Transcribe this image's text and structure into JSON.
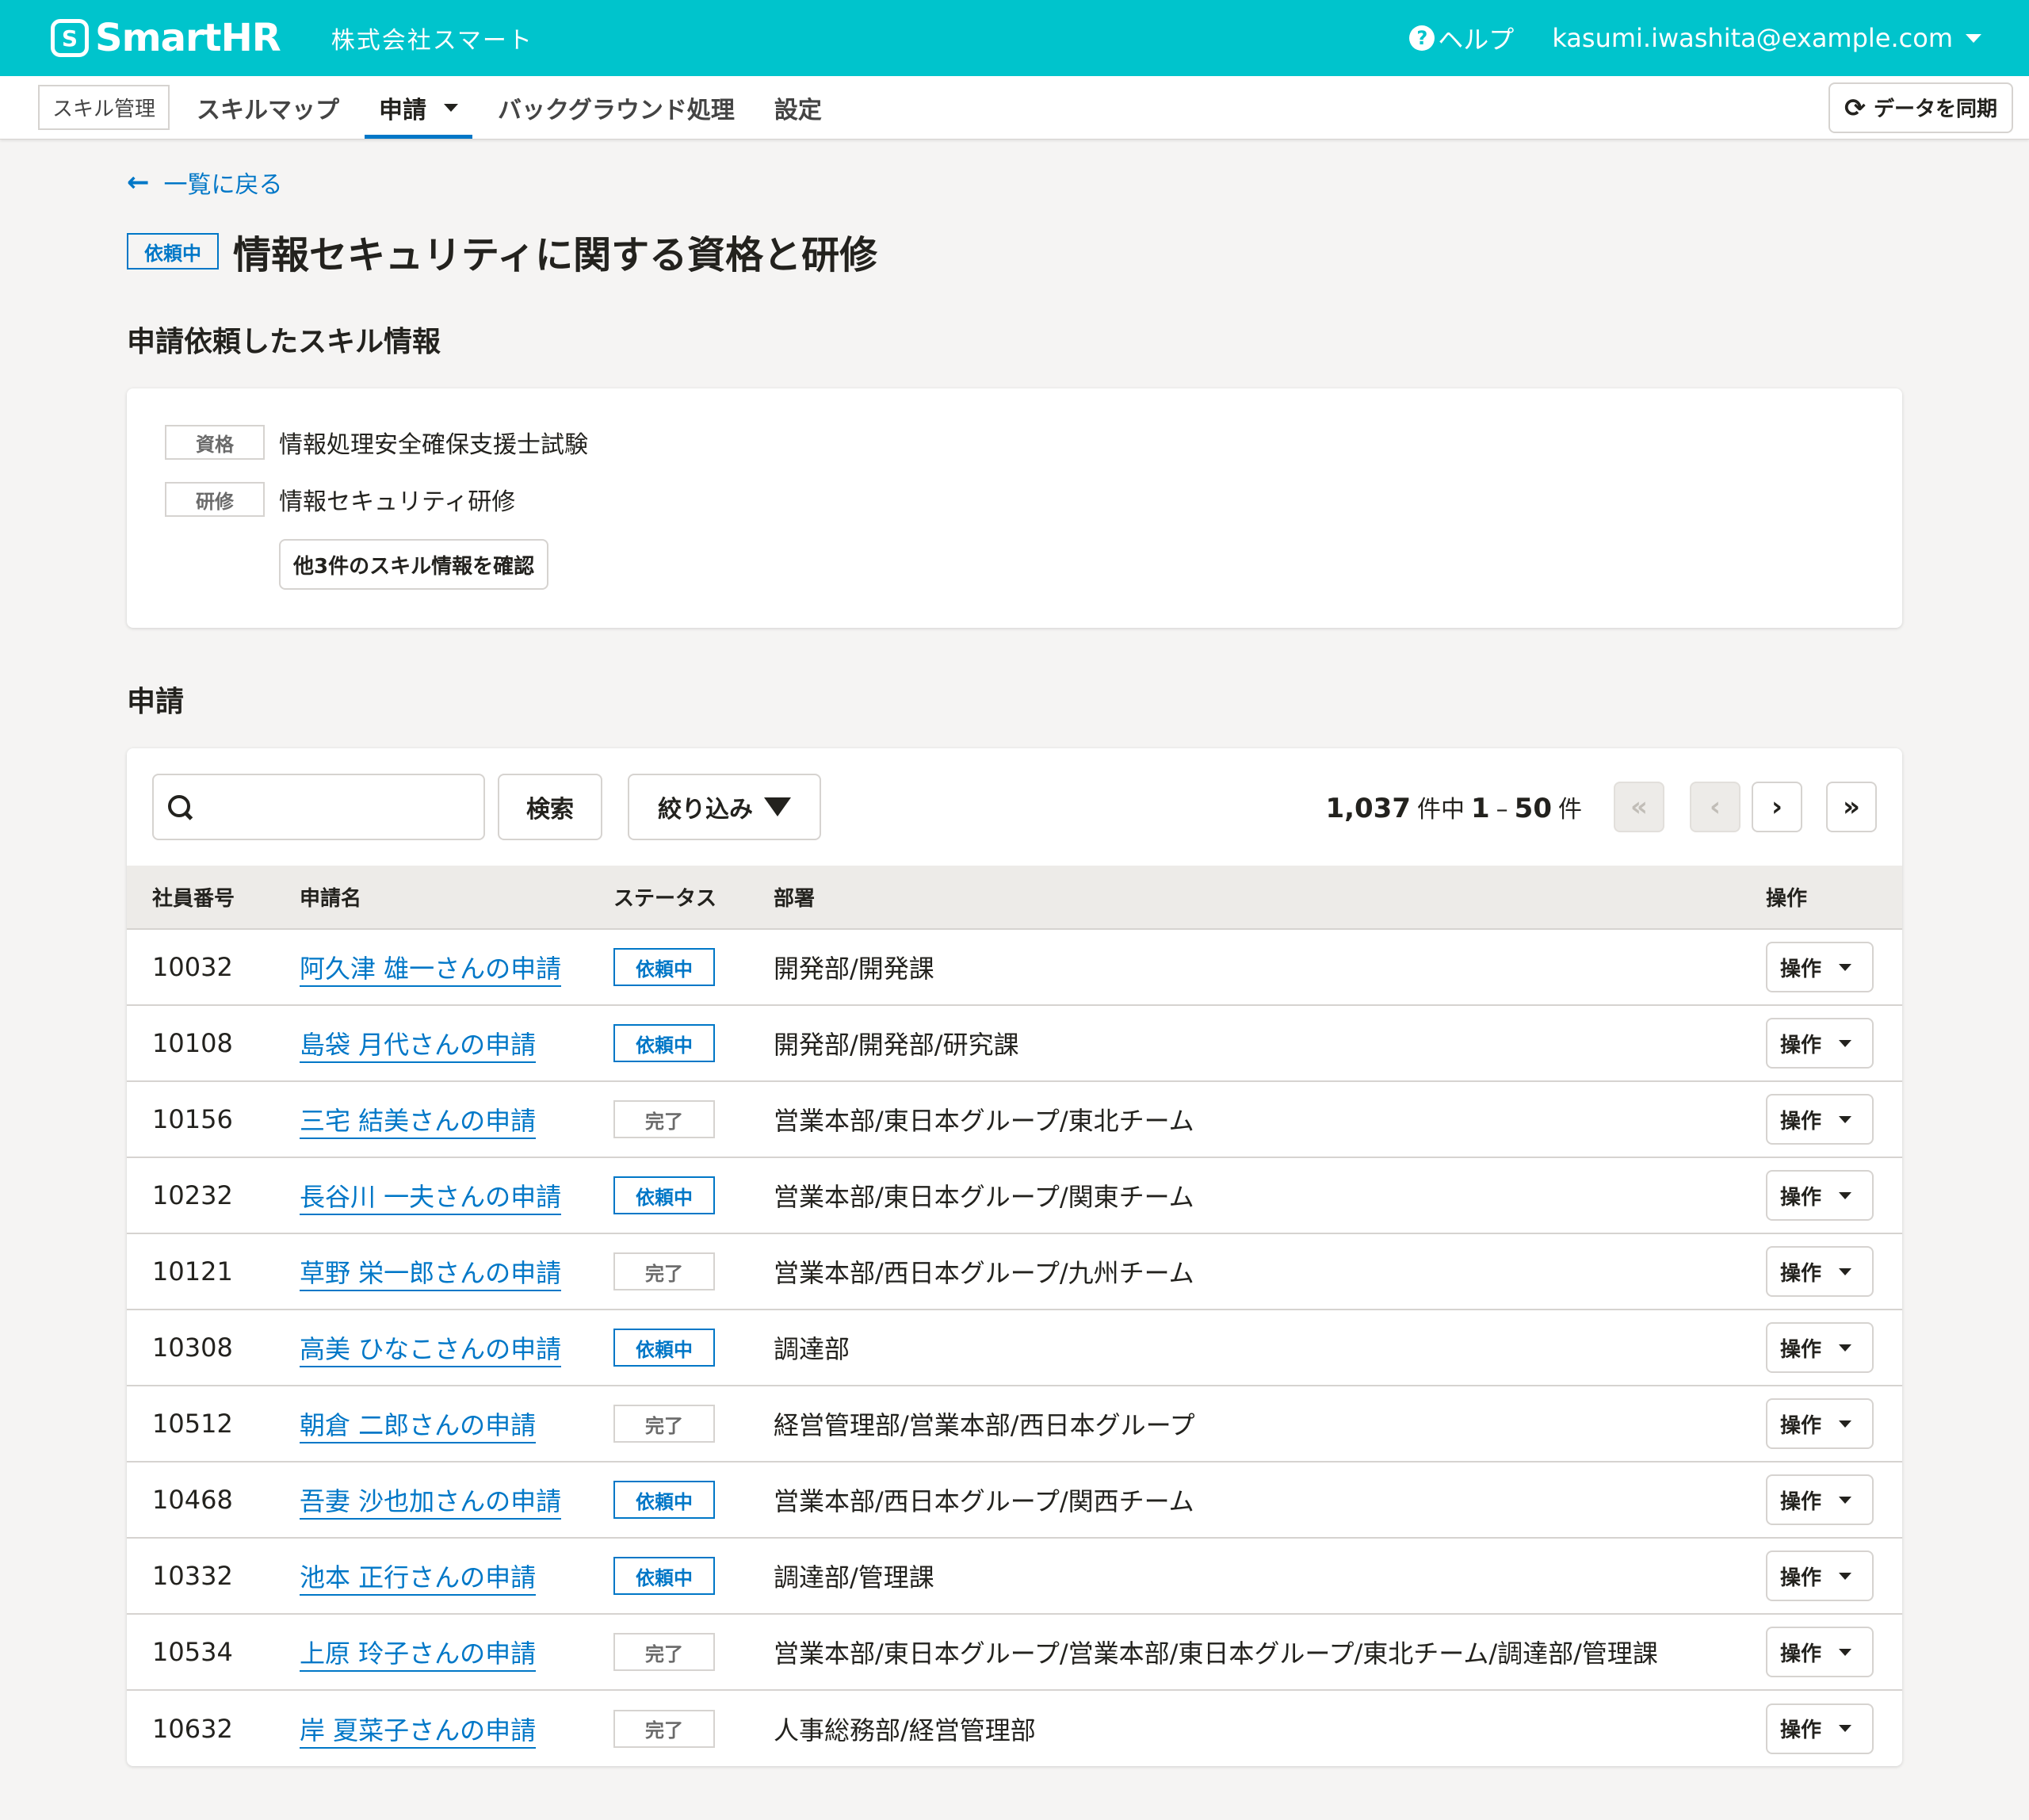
{
  "header": {
    "logo_text": "SmartHR",
    "company": "株式会社スマート",
    "help_label": "ヘルプ",
    "user_email": "kasumi.iwashita@example.com"
  },
  "appnav": {
    "app_name": "スキル管理",
    "items": [
      "スキルマップ",
      "申請",
      "バックグラウンド処理",
      "設定"
    ],
    "active_item": "申請",
    "sync_label": "データを同期"
  },
  "page": {
    "back_label": "一覧に戻る",
    "status": "依頼中",
    "title": "情報セキュリティに関する資格と研修"
  },
  "skills_section": {
    "title": "申請依頼したスキル情報",
    "items": [
      {
        "type": "資格",
        "name": "情報処理安全確保支援士試験"
      },
      {
        "type": "研修",
        "name": "情報セキュリティ研修"
      }
    ],
    "more_label": "他3件のスキル情報を確認"
  },
  "requests_section": {
    "title": "申請",
    "search_placeholder": "",
    "search_button": "検索",
    "filter_button": "絞り込み",
    "pager": {
      "total": "1,037",
      "total_suffix": "件中",
      "range_start": "1",
      "range_sep": "–",
      "range_end": "50",
      "range_suffix": "件"
    },
    "columns": [
      "社員番号",
      "申請名",
      "ステータス",
      "部署",
      "操作"
    ],
    "rows": [
      {
        "id": "10032",
        "name": "阿久津 雄一さんの申請",
        "status": "依頼中",
        "dept": "開発部/開発課",
        "op": "操作"
      },
      {
        "id": "10108",
        "name": "島袋 月代さんの申請",
        "status": "依頼中",
        "dept": "開発部/開発部/研究課",
        "op": "操作"
      },
      {
        "id": "10156",
        "name": "三宅 結美さんの申請",
        "status": "完了",
        "dept": "営業本部/東日本グループ/東北チーム",
        "op": "操作"
      },
      {
        "id": "10232",
        "name": "長谷川 一夫さんの申請",
        "status": "依頼中",
        "dept": "営業本部/東日本グループ/関東チーム",
        "op": "操作"
      },
      {
        "id": "10121",
        "name": "草野 栄一郎さんの申請",
        "status": "完了",
        "dept": "営業本部/西日本グループ/九州チーム",
        "op": "操作"
      },
      {
        "id": "10308",
        "name": "高美 ひなこさんの申請",
        "status": "依頼中",
        "dept": "調達部",
        "op": "操作"
      },
      {
        "id": "10512",
        "name": "朝倉 二郎さんの申請",
        "status": "完了",
        "dept": "経営管理部/営業本部/西日本グループ",
        "op": "操作"
      },
      {
        "id": "10468",
        "name": "吾妻 沙也加さんの申請",
        "status": "依頼中",
        "dept": "営業本部/西日本グループ/関西チーム",
        "op": "操作"
      },
      {
        "id": "10332",
        "name": "池本 正行さんの申請",
        "status": "依頼中",
        "dept": "調達部/管理課",
        "op": "操作"
      },
      {
        "id": "10534",
        "name": "上原 玲子さんの申請",
        "status": "完了",
        "dept": "営業本部/東日本グループ/営業本部/東日本グループ/東北チーム/調達部/管理課",
        "op": "操作"
      },
      {
        "id": "10632",
        "name": "岸 夏菜子さんの申請",
        "status": "完了",
        "dept": "人事総務部/経営管理部",
        "op": "操作"
      }
    ]
  },
  "colors": {
    "header_bg": "#00c4cc",
    "link": "#0077c7",
    "page_bg": "#f5f4f3"
  }
}
